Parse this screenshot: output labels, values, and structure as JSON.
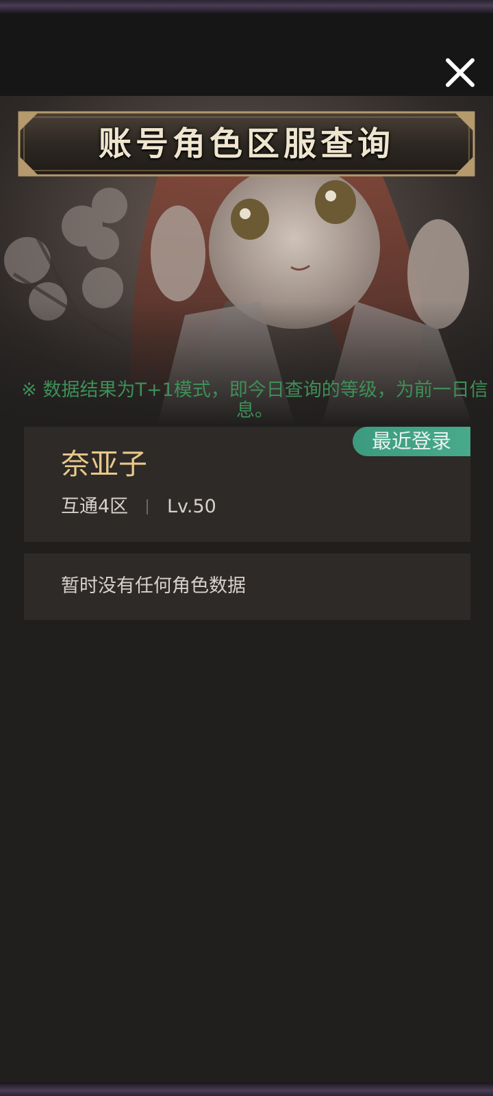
{
  "header": {
    "close_icon": "close-icon"
  },
  "banner": {
    "title": "账号角色区服查询"
  },
  "notice": {
    "text": "※ 数据结果为T+1模式，即今日查询的等级，为前一日信息。"
  },
  "roles": [
    {
      "badge": "最近登录",
      "name": "奈亚子",
      "server": "互通4区",
      "separator": "|",
      "level": "Lv.50"
    }
  ],
  "empty": {
    "text": "暂时没有任何角色数据"
  },
  "colors": {
    "background": "#211f1e",
    "header": "#161616",
    "card": "#2e2a28",
    "notice": "#3f8f58",
    "badge": "#48a98b",
    "role_name": "#e9c88a",
    "banner_text": "#efe5cf"
  }
}
